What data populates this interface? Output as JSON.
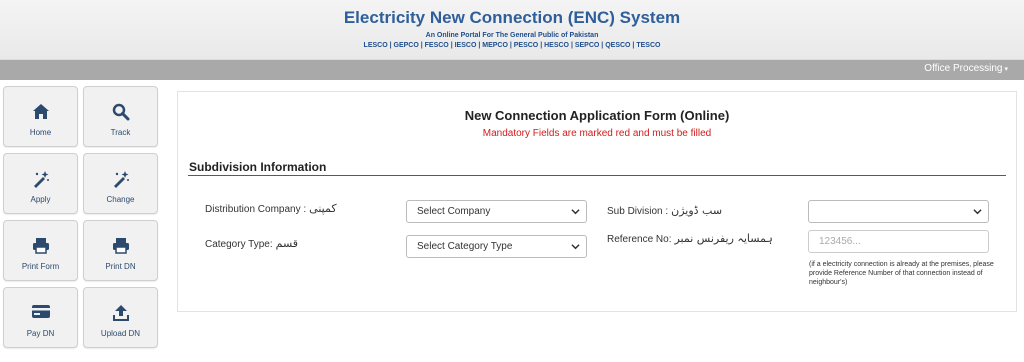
{
  "header": {
    "title": "Electricity New Connection (ENC) System",
    "tagline": "An Online Portal For The General Public of Pakistan",
    "companies": "LESCO | GEPCO | FESCO | IESCO | MEPCO | PESCO | HESCO | SEPCO | QESCO | TESCO"
  },
  "navbar": {
    "office_processing": "Office Processing"
  },
  "sidebar": {
    "tiles": [
      {
        "label": "Home",
        "icon": "home-icon"
      },
      {
        "label": "Track",
        "icon": "search-icon"
      },
      {
        "label": "Apply",
        "icon": "magic-wand-icon"
      },
      {
        "label": "Change",
        "icon": "magic-wand-icon"
      },
      {
        "label": "Print Form",
        "icon": "printer-icon"
      },
      {
        "label": "Print DN",
        "icon": "printer-icon"
      },
      {
        "label": "Pay DN",
        "icon": "credit-card-icon"
      },
      {
        "label": "Upload DN",
        "icon": "upload-icon"
      }
    ]
  },
  "form": {
    "title": "New Connection Application Form (Online)",
    "mandatory_note": "Mandatory Fields are marked red and must be filled",
    "section_title": "Subdivision Information",
    "distribution_company": {
      "label": "Distribution Company :",
      "urdu": "کمپنی",
      "selected": "Select Company"
    },
    "category_type": {
      "label": "Category Type:",
      "urdu": "قسم",
      "selected": "Select Category Type"
    },
    "sub_division": {
      "label": "Sub Division :",
      "urdu": "سب ڈویژن",
      "selected": ""
    },
    "reference_no": {
      "label": "Reference No:",
      "urdu": "ہمسایہ ریفرنس نمبر",
      "placeholder": "123456...",
      "help": "(if a electricity connection is already at the premises, please provide Reference Number of that connection instead of neighbour's)"
    }
  },
  "colors": {
    "brand_blue": "#2f5f9a",
    "mandatory_red": "#d11b1b",
    "section_rule": "#8b4a2c",
    "navbar_gray": "#a9a9a9"
  }
}
